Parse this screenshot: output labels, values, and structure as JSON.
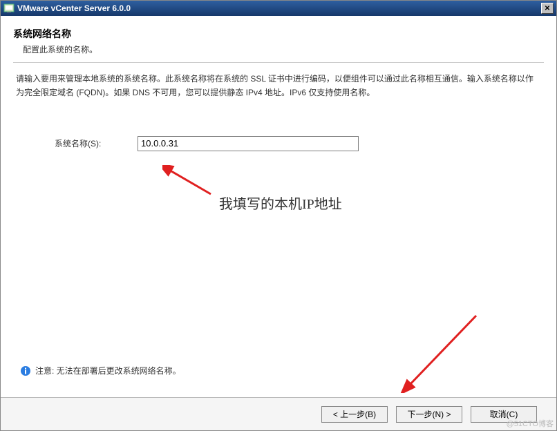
{
  "window": {
    "title": "VMware vCenter Server 6.0.0"
  },
  "header": {
    "title": "系统网络名称",
    "subtitle": "配置此系统的名称。"
  },
  "body": {
    "instructions": "请输入要用来管理本地系统的系统名称。此系统名称将在系统的 SSL 证书中进行编码，以便组件可以通过此名称相互通信。输入系统名称以作为完全限定域名 (FQDN)。如果 DNS 不可用，您可以提供静态 IPv4 地址。IPv6 仅支持使用名称。",
    "field_label": "系统名称(S):",
    "field_value": "10.0.0.31"
  },
  "annotation": {
    "text": "我填写的本机IP地址"
  },
  "notice": {
    "text": "注意: 无法在部署后更改系统网络名称。"
  },
  "buttons": {
    "back": "< 上一步(B)",
    "next": "下一步(N) >",
    "cancel": "取消(C)"
  },
  "watermark": "@51CTO博客"
}
